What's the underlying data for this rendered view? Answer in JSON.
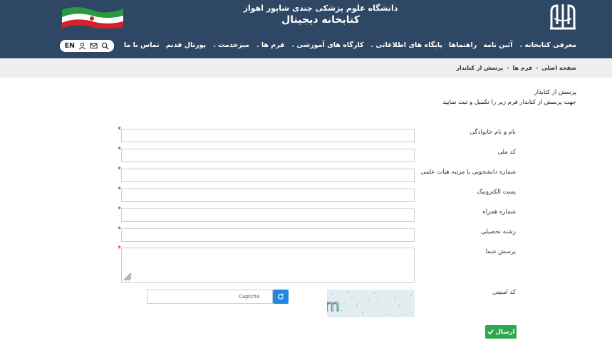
{
  "header": {
    "university_title": "دانشگاه علوم پزشکی جندی شاپور اهواز",
    "library_title": "کتابخانه دیجیتال",
    "colors": {
      "bar": "#2e4765",
      "text": "#ffffff"
    }
  },
  "nav": {
    "items": [
      {
        "label": "معرفی کتابخانه",
        "caret": true
      },
      {
        "label": "آئین نامه",
        "caret": false
      },
      {
        "label": "راهنماها",
        "caret": false
      },
      {
        "label": "پایگاه های اطلاعاتی",
        "caret": true
      },
      {
        "label": "کارگاه های آموزشی",
        "caret": true
      },
      {
        "label": "فرم ها",
        "caret": true
      },
      {
        "label": "میزخدمت",
        "caret": true
      },
      {
        "label": "پورتال قدیم",
        "caret": false
      },
      {
        "label": "تماس با ما",
        "caret": false
      }
    ],
    "caret_glyph": "⌄"
  },
  "tools": {
    "lang": "EN",
    "icons": [
      "search-icon",
      "mail-icon",
      "user-icon"
    ]
  },
  "breadcrumb": {
    "items": [
      "صفحه اصلی",
      "فرم ها",
      "پرسش از کتابدار"
    ],
    "sep": "›"
  },
  "intro": {
    "title": "پرسش از کتابدار",
    "subtitle": "جهت پرسش از کتابدار فرم زیر را تکمیل و ثبت نمایید"
  },
  "form": {
    "fields": [
      {
        "label": "نام و نام خانوادگی",
        "value": "",
        "required": true
      },
      {
        "label": "کد ملی",
        "value": "",
        "required": true
      },
      {
        "label": "شماره دانشجویی یا مرتبه هیات علمی",
        "value": "",
        "required": true
      },
      {
        "label": "پست الکترونیک",
        "value": "",
        "required": true
      },
      {
        "label": "شماره همراه",
        "value": "",
        "required": true
      },
      {
        "label": "رشته تحصیلی",
        "value": "",
        "required": true
      }
    ],
    "question_label": "پرسش شما",
    "required_mark": "*",
    "captcha_label": "کد امنیتی",
    "captcha_placeholder": "Captcha",
    "captcha_text": "wb46m",
    "submit_label": "ارسال",
    "submit_color": "#2ea84a",
    "refresh_color": "#1e88e5"
  }
}
